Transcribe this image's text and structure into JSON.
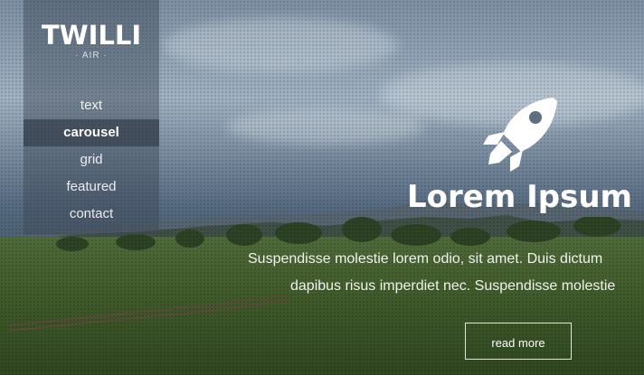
{
  "brand": {
    "logo": "TWILLI",
    "sub": "· AIR ·"
  },
  "nav": {
    "items": [
      {
        "label": "text"
      },
      {
        "label": "carousel"
      },
      {
        "label": "grid"
      },
      {
        "label": "featured"
      },
      {
        "label": "contact"
      }
    ],
    "active": "carousel"
  },
  "hero": {
    "icon": "rocket-icon",
    "title": "Lorem Ipsum",
    "description_line1": "Suspendisse molestie lorem odio, sit amet. Duis dictum",
    "description_line2": "dapibus risus imperdiet nec. Suspendisse molestie",
    "button_label": "read more"
  },
  "colors": {
    "text": "#ffffff",
    "nav_bg": "#3c4655",
    "field": "#46602f",
    "sky": "#8d9fb1"
  }
}
